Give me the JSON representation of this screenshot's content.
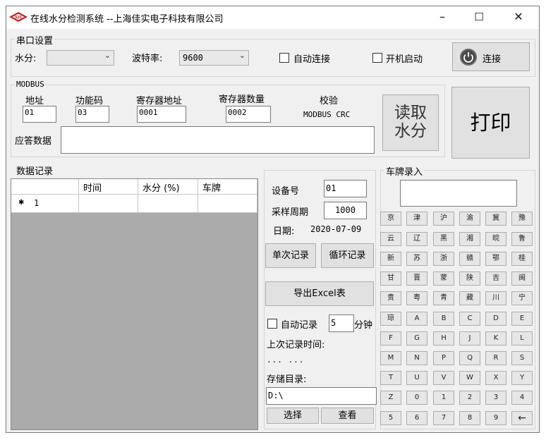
{
  "window": {
    "title": "在线水分检测系统  --上海佳实电子科技有限公司",
    "logo_text": "SJS",
    "minimize": "–",
    "maximize": "☐",
    "close": "✕"
  },
  "serial": {
    "group_label": "串口设置",
    "moisture_label": "水分:",
    "moisture_value": "",
    "baud_label": "波特率:",
    "baud_value": "9600",
    "auto_connect_label": "自动连接",
    "auto_connect_checked": false,
    "boot_start_label": "开机启动",
    "boot_start_checked": false,
    "connect_label": "连接"
  },
  "modbus": {
    "group_label": "MODBUS",
    "address_label": "地址",
    "address_value": "01",
    "function_label": "功能码",
    "function_value": "03",
    "register_addr_label": "寄存器地址",
    "register_addr_value": "0001",
    "register_count_label": "寄存器数量",
    "register_count_value": "0002",
    "checksum_label": "校验",
    "checksum_value": "MODBUS CRC",
    "response_label": "应答数据",
    "response_value": "",
    "read_line1": "读取",
    "read_line2": "水分"
  },
  "print_label": "打印",
  "records": {
    "group_label": "数据记录",
    "columns": [
      "",
      "时间",
      "水分 (%)",
      "车牌"
    ],
    "rows": [
      {
        "marker": "✱",
        "index": "1",
        "time": "",
        "moisture": "",
        "plate": ""
      }
    ]
  },
  "controls": {
    "device_label": "设备号",
    "device_value": "01",
    "period_label": "采样周期",
    "period_value": "1000",
    "date_label": "日期:",
    "date_value": "2020-07-09",
    "single_record": "单次记录",
    "loop_record": "循环记录",
    "export": "导出Excel表",
    "auto_record_label": "自动记录",
    "auto_record_checked": false,
    "auto_minutes": "5",
    "minutes_unit": "分钟",
    "last_time_label": "上次记录时间:",
    "last_time_value": "... ...",
    "storage_label": "存储目录:",
    "storage_value": "D:\\",
    "choose": "选择",
    "view": "查看"
  },
  "plate_entry": {
    "group_label": "车牌录入",
    "display_value": "",
    "keys": [
      [
        "京",
        "津",
        "沪",
        "渝",
        "冀",
        "豫"
      ],
      [
        "云",
        "辽",
        "黑",
        "湘",
        "皖",
        "鲁"
      ],
      [
        "新",
        "苏",
        "浙",
        "赣",
        "鄂",
        "桂"
      ],
      [
        "甘",
        "晋",
        "蒙",
        "陕",
        "吉",
        "闽"
      ],
      [
        "贵",
        "粤",
        "青",
        "藏",
        "川",
        "宁"
      ],
      [
        "琼",
        "A",
        "B",
        "C",
        "D",
        "E"
      ],
      [
        "F",
        "G",
        "H",
        "J",
        "K",
        "L"
      ],
      [
        "M",
        "N",
        "P",
        "Q",
        "R",
        "S"
      ],
      [
        "T",
        "U",
        "V",
        "W",
        "X",
        "Y"
      ],
      [
        "Z",
        "0",
        "1",
        "2",
        "3",
        "4"
      ],
      [
        "5",
        "6",
        "7",
        "8",
        "9",
        "←"
      ]
    ]
  },
  "colors": {
    "window_bg": "#f0f0f0",
    "grid_bg": "#ababab",
    "button_bg": "#e1e1e1",
    "logo_red": "#c8201e"
  }
}
